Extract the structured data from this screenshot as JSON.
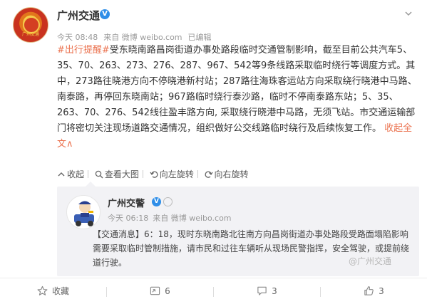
{
  "post": {
    "user_name": "广州交通",
    "time": "今天 08:48",
    "source": "来自 微博 weibo.com",
    "edited": "已编辑",
    "topic": "#出行提醒#",
    "body_main": "受东晓南路昌岗街道办事处路段临时交通管制影响，截至目前公共汽车5、35、70、263、273、276、287、967、542等9条线路采取临时绕行等调度方式。其中，273路往晓港方向不停晓港新村站；287路往海珠客运站方向采取绕行晓港中马路、南泰路，再停回东晓南站；967路临时绕行泰沙路，临时不停南泰路东站；5、35、263、70、276、542线往盈丰路方向, 采取绕行晓港中马路，无须飞站。市交通运输部门将密切关注现场道路交通情况，组织做好公交线路临时绕行及后续恢复工作。",
    "collapse_link": "收起全文",
    "collapse_arrow": "∧"
  },
  "actions": {
    "collapse": "收起",
    "view_large": "查看大图",
    "rotate_left": "向左旋转",
    "rotate_right": "向右旋转"
  },
  "repost": {
    "user_name": "广州交警",
    "time": "今天 06:18",
    "source": "来自 微博 weibo.com",
    "text": "【交通消息】6：18，现时东晓南路北往南方向昌岗街道办事处路段受路面塌陷影响需要采取临时管制措施，请市民和过往车辆听从现场民警指挥，安全驾驶，或提前绕道行驶。"
  },
  "watermark": "@广州交通",
  "footer": {
    "favorite": "收藏",
    "repost_count": "6",
    "comment_count": "3",
    "like_count": "3"
  },
  "colors": {
    "link": "#eb7350",
    "verified": "#2f8ee8",
    "repost_bg": "#f2f2f5"
  }
}
